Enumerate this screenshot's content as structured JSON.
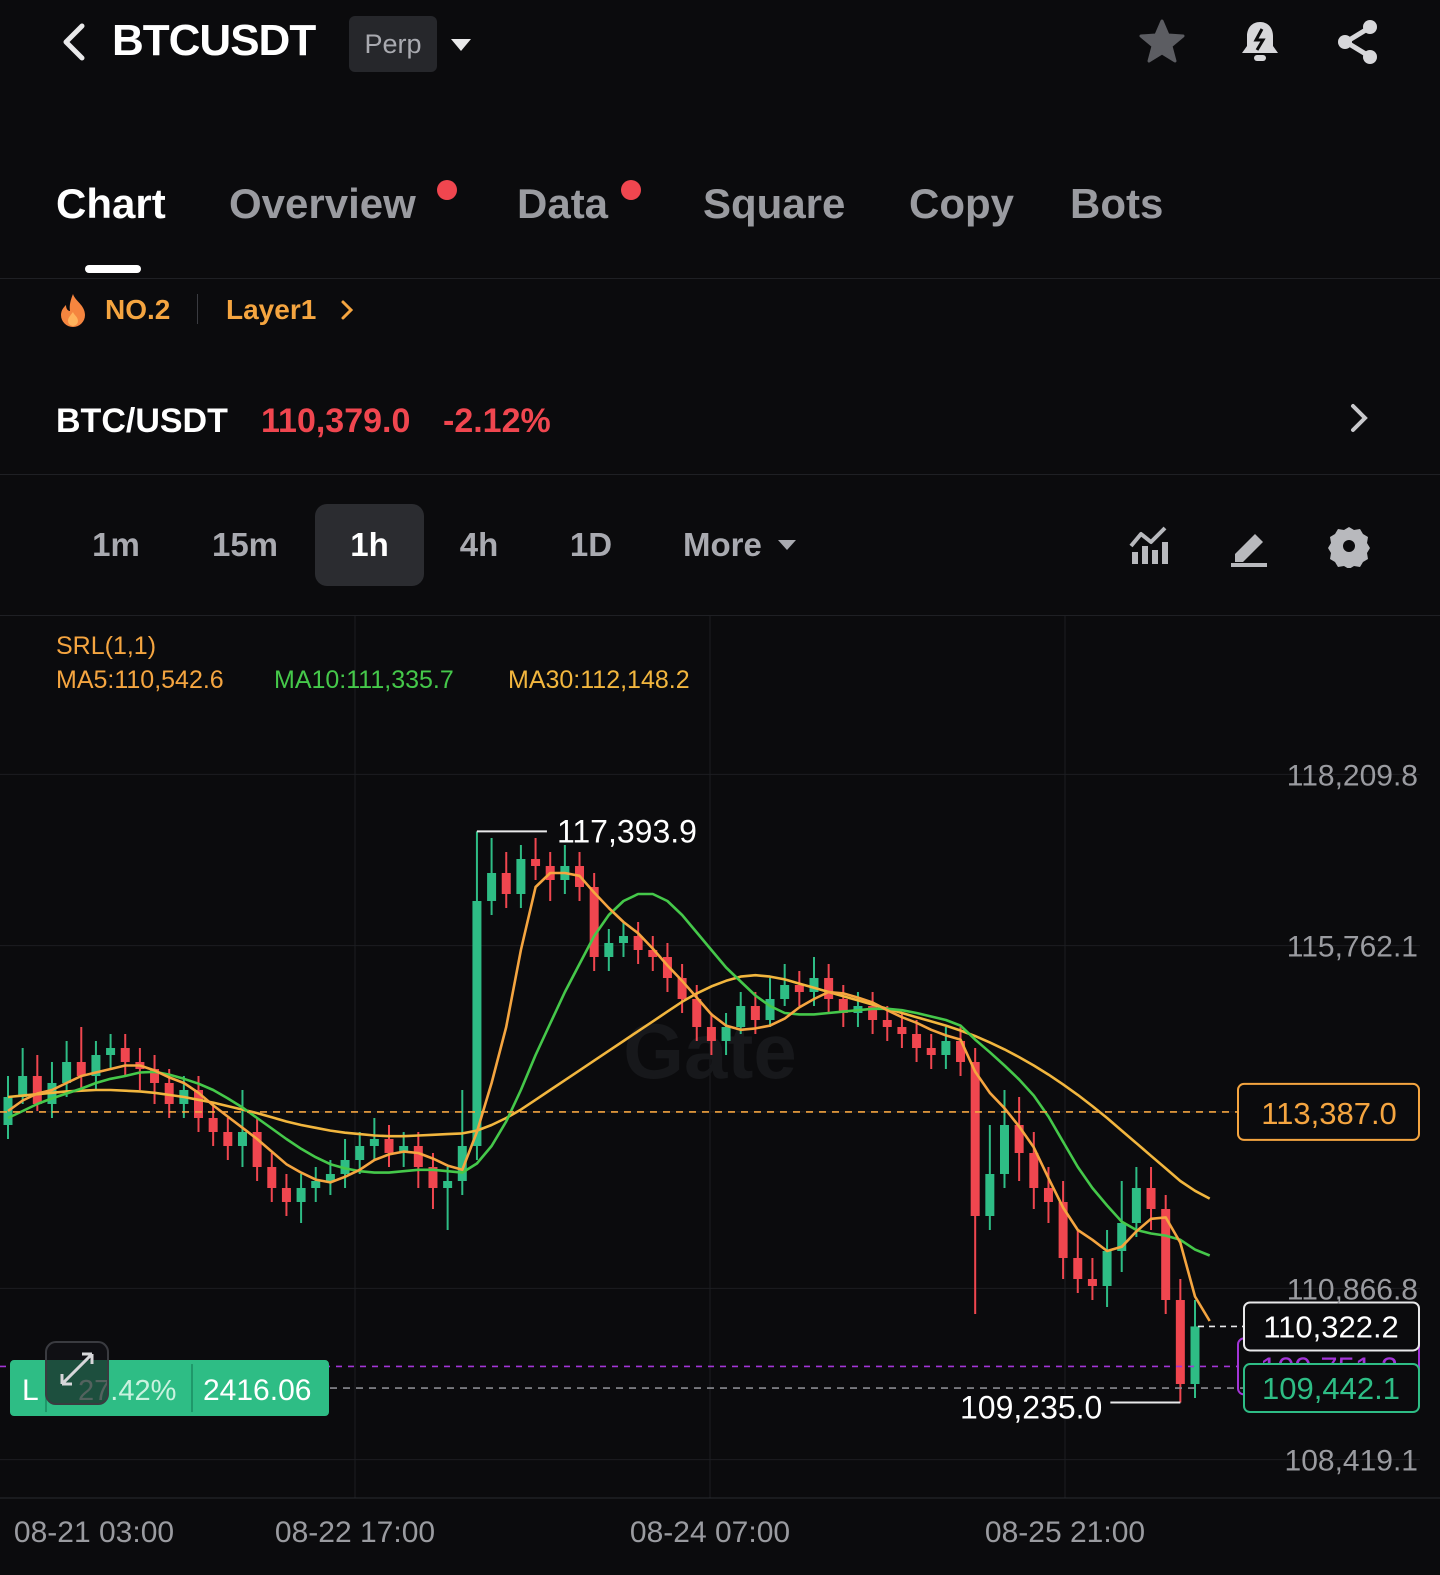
{
  "header": {
    "symbol": "BTCUSDT",
    "contract_type": "Perp",
    "icons": [
      "back-icon",
      "star-icon",
      "bell-icon",
      "share-icon"
    ]
  },
  "tabs": [
    {
      "label": "Chart",
      "active": true,
      "dot": false
    },
    {
      "label": "Overview",
      "active": false,
      "dot": true
    },
    {
      "label": "Data",
      "active": false,
      "dot": true
    },
    {
      "label": "Square",
      "active": false,
      "dot": false
    },
    {
      "label": "Copy",
      "active": false,
      "dot": false
    },
    {
      "label": "Bots",
      "active": false,
      "dot": false
    }
  ],
  "rank": {
    "label": "NO.2",
    "category": "Layer1"
  },
  "pair": {
    "name": "BTC/USDT",
    "price": "110,379.0",
    "change": "-2.12%"
  },
  "intervals": {
    "items": [
      "1m",
      "15m",
      "1h",
      "4h",
      "1D"
    ],
    "active": "1h",
    "more": "More"
  },
  "chart": {
    "indicator_title": "SRL(1,1)",
    "ma5": "MA5:110,542.6",
    "ma10": "MA10:111,335.7",
    "ma30": "MA30:112,148.2",
    "watermark": "Gate",
    "high_marker": "117,393.9",
    "low_marker": "109,235.0",
    "alert_price": "113,387.0",
    "last_price": "110,322.2",
    "hidden_price": "109,751.2",
    "mark_price": "109,442.1",
    "position": {
      "side": "L",
      "pnl": "27.42%",
      "size": "2416.06"
    }
  },
  "colors": {
    "up": "#2ebd85",
    "down": "#f0464f",
    "ma5": "#f5a540",
    "ma10": "#45c84a",
    "ma30": "#f2b63e",
    "accent": "#f5a540",
    "background": "#0b0b0d"
  },
  "chart_data": {
    "type": "candlestick",
    "title": "",
    "xlabel": "",
    "ylabel": "",
    "ylim": [
      107900,
      118900
    ],
    "y_ticks": [
      "118,209.8",
      "115,762.1",
      "113,387.0",
      "110,866.8",
      "108,419.1"
    ],
    "x_ticks": [
      "08-21 03:00",
      "08-22 17:00",
      "08-24 07:00",
      "08-25 21:00"
    ],
    "high": 117393.9,
    "low": 109235.0,
    "candles": [
      {
        "o": 113200,
        "c": 113600,
        "h": 113900,
        "l": 113000
      },
      {
        "o": 113600,
        "c": 113900,
        "h": 114300,
        "l": 113500
      },
      {
        "o": 113900,
        "c": 113500,
        "h": 114200,
        "l": 113400
      },
      {
        "o": 113500,
        "c": 113800,
        "h": 114100,
        "l": 113300
      },
      {
        "o": 113800,
        "c": 114100,
        "h": 114400,
        "l": 113600
      },
      {
        "o": 114100,
        "c": 113900,
        "h": 114600,
        "l": 113700
      },
      {
        "o": 113900,
        "c": 114200,
        "h": 114400,
        "l": 113700
      },
      {
        "o": 114200,
        "c": 114300,
        "h": 114500,
        "l": 114000
      },
      {
        "o": 114300,
        "c": 114100,
        "h": 114500,
        "l": 113900
      },
      {
        "o": 114100,
        "c": 114000,
        "h": 114300,
        "l": 113700
      },
      {
        "o": 114000,
        "c": 113800,
        "h": 114200,
        "l": 113500
      },
      {
        "o": 113800,
        "c": 113500,
        "h": 114000,
        "l": 113300
      },
      {
        "o": 113500,
        "c": 113700,
        "h": 113900,
        "l": 113300
      },
      {
        "o": 113700,
        "c": 113300,
        "h": 113900,
        "l": 113100
      },
      {
        "o": 113300,
        "c": 113100,
        "h": 113500,
        "l": 112900
      },
      {
        "o": 113100,
        "c": 112900,
        "h": 113300,
        "l": 112700
      },
      {
        "o": 112900,
        "c": 113100,
        "h": 113700,
        "l": 112600
      },
      {
        "o": 113100,
        "c": 112600,
        "h": 113300,
        "l": 112400
      },
      {
        "o": 112600,
        "c": 112300,
        "h": 112800,
        "l": 112100
      },
      {
        "o": 112300,
        "c": 112100,
        "h": 112500,
        "l": 111900
      },
      {
        "o": 112100,
        "c": 112300,
        "h": 112500,
        "l": 111800
      },
      {
        "o": 112300,
        "c": 112400,
        "h": 112600,
        "l": 112100
      },
      {
        "o": 112400,
        "c": 112500,
        "h": 112700,
        "l": 112200
      },
      {
        "o": 112500,
        "c": 112700,
        "h": 113000,
        "l": 112300
      },
      {
        "o": 112700,
        "c": 112900,
        "h": 113100,
        "l": 112500
      },
      {
        "o": 112900,
        "c": 113000,
        "h": 113300,
        "l": 112700
      },
      {
        "o": 113000,
        "c": 112800,
        "h": 113200,
        "l": 112600
      },
      {
        "o": 112800,
        "c": 112900,
        "h": 113100,
        "l": 112600
      },
      {
        "o": 112900,
        "c": 112600,
        "h": 113100,
        "l": 112300
      },
      {
        "o": 112600,
        "c": 112300,
        "h": 112800,
        "l": 112000
      },
      {
        "o": 112300,
        "c": 112400,
        "h": 112600,
        "l": 111700
      },
      {
        "o": 112400,
        "c": 112900,
        "h": 113700,
        "l": 112200
      },
      {
        "o": 112900,
        "c": 116400,
        "h": 117393.9,
        "l": 112700
      },
      {
        "o": 116400,
        "c": 116800,
        "h": 117300,
        "l": 116200
      },
      {
        "o": 116800,
        "c": 116500,
        "h": 117100,
        "l": 116300
      },
      {
        "o": 116500,
        "c": 117000,
        "h": 117200,
        "l": 116300
      },
      {
        "o": 117000,
        "c": 116900,
        "h": 117300,
        "l": 116700
      },
      {
        "o": 116900,
        "c": 116700,
        "h": 117100,
        "l": 116400
      },
      {
        "o": 116700,
        "c": 116900,
        "h": 117200,
        "l": 116500
      },
      {
        "o": 116900,
        "c": 116600,
        "h": 117100,
        "l": 116400
      },
      {
        "o": 116600,
        "c": 115600,
        "h": 116800,
        "l": 115400
      },
      {
        "o": 115600,
        "c": 115800,
        "h": 116000,
        "l": 115400
      },
      {
        "o": 115800,
        "c": 115900,
        "h": 116100,
        "l": 115600
      },
      {
        "o": 115900,
        "c": 115700,
        "h": 116100,
        "l": 115500
      },
      {
        "o": 115700,
        "c": 115600,
        "h": 115900,
        "l": 115400
      },
      {
        "o": 115600,
        "c": 115300,
        "h": 115800,
        "l": 115100
      },
      {
        "o": 115300,
        "c": 115000,
        "h": 115500,
        "l": 114800
      },
      {
        "o": 115000,
        "c": 114600,
        "h": 115200,
        "l": 114400
      },
      {
        "o": 114600,
        "c": 114400,
        "h": 114800,
        "l": 114200
      },
      {
        "o": 114400,
        "c": 114600,
        "h": 114800,
        "l": 114200
      },
      {
        "o": 114600,
        "c": 114900,
        "h": 115100,
        "l": 114500
      },
      {
        "o": 114900,
        "c": 114700,
        "h": 115100,
        "l": 114500
      },
      {
        "o": 114700,
        "c": 115000,
        "h": 115300,
        "l": 114600
      },
      {
        "o": 115000,
        "c": 115200,
        "h": 115500,
        "l": 114900
      },
      {
        "o": 115200,
        "c": 115100,
        "h": 115400,
        "l": 114900
      },
      {
        "o": 115100,
        "c": 115300,
        "h": 115600,
        "l": 114900
      },
      {
        "o": 115300,
        "c": 115000,
        "h": 115500,
        "l": 114800
      },
      {
        "o": 115000,
        "c": 114800,
        "h": 115200,
        "l": 114600
      },
      {
        "o": 114800,
        "c": 114900,
        "h": 115100,
        "l": 114600
      },
      {
        "o": 114900,
        "c": 114700,
        "h": 115100,
        "l": 114500
      },
      {
        "o": 114700,
        "c": 114600,
        "h": 114900,
        "l": 114400
      },
      {
        "o": 114600,
        "c": 114500,
        "h": 114800,
        "l": 114300
      },
      {
        "o": 114500,
        "c": 114300,
        "h": 114700,
        "l": 114100
      },
      {
        "o": 114300,
        "c": 114200,
        "h": 114500,
        "l": 114000
      },
      {
        "o": 114200,
        "c": 114400,
        "h": 114600,
        "l": 114000
      },
      {
        "o": 114400,
        "c": 114100,
        "h": 114600,
        "l": 113900
      },
      {
        "o": 114100,
        "c": 111900,
        "h": 114300,
        "l": 110500
      },
      {
        "o": 111900,
        "c": 112500,
        "h": 113200,
        "l": 111700
      },
      {
        "o": 112500,
        "c": 113200,
        "h": 113700,
        "l": 112300
      },
      {
        "o": 113200,
        "c": 112800,
        "h": 113600,
        "l": 112400
      },
      {
        "o": 112800,
        "c": 112300,
        "h": 113100,
        "l": 112000
      },
      {
        "o": 112300,
        "c": 112100,
        "h": 112600,
        "l": 111800
      },
      {
        "o": 112100,
        "c": 111300,
        "h": 112400,
        "l": 111000
      },
      {
        "o": 111300,
        "c": 111000,
        "h": 111700,
        "l": 110800
      },
      {
        "o": 111000,
        "c": 110900,
        "h": 111300,
        "l": 110700
      },
      {
        "o": 110900,
        "c": 111400,
        "h": 111700,
        "l": 110600
      },
      {
        "o": 111400,
        "c": 111800,
        "h": 112400,
        "l": 111100
      },
      {
        "o": 111800,
        "c": 112300,
        "h": 112600,
        "l": 111600
      },
      {
        "o": 112300,
        "c": 112000,
        "h": 112600,
        "l": 111700
      },
      {
        "o": 112000,
        "c": 110700,
        "h": 112200,
        "l": 110500
      },
      {
        "o": 110700,
        "c": 109500,
        "h": 111000,
        "l": 109235.0
      },
      {
        "o": 109500,
        "c": 110322.2,
        "h": 110700,
        "l": 109300
      }
    ],
    "ma5": [
      113400,
      113550,
      113650,
      113700,
      113800,
      113900,
      113950,
      114000,
      114050,
      114050,
      113980,
      113880,
      113800,
      113660,
      113480,
      113320,
      113160,
      113000,
      112820,
      112640,
      112520,
      112420,
      112380,
      112460,
      112560,
      112700,
      112780,
      112820,
      112800,
      112720,
      112620,
      112560,
      113100,
      113800,
      114600,
      115700,
      116600,
      116800,
      116800,
      116760,
      116520,
      116300,
      116100,
      115940,
      115720,
      115480,
      115260,
      115020,
      114780,
      114620,
      114560,
      114580,
      114620,
      114720,
      114880,
      115000,
      115100,
      115080,
      115020,
      114950,
      114840,
      114740,
      114660,
      114560,
      114480,
      114420,
      113960,
      113660,
      113440,
      113180,
      112880,
      112440,
      112020,
      111700,
      111560,
      111400,
      111460,
      111680,
      111860,
      111880,
      111520,
      110750,
      110400
    ],
    "ma10": [
      113300,
      113400,
      113500,
      113580,
      113650,
      113720,
      113800,
      113860,
      113900,
      113950,
      113960,
      113920,
      113860,
      113790,
      113700,
      113580,
      113450,
      113300,
      113150,
      113000,
      112860,
      112740,
      112640,
      112580,
      112540,
      112520,
      112520,
      112540,
      112560,
      112560,
      112540,
      112520,
      112650,
      112900,
      113250,
      113700,
      114200,
      114650,
      115100,
      115500,
      115900,
      116200,
      116400,
      116500,
      116500,
      116400,
      116200,
      115950,
      115700,
      115450,
      115250,
      115050,
      114900,
      114800,
      114780,
      114780,
      114800,
      114820,
      114840,
      114860,
      114860,
      114840,
      114800,
      114750,
      114700,
      114620,
      114420,
      114240,
      114050,
      113850,
      113620,
      113320,
      112960,
      112600,
      112300,
      112050,
      111820,
      111700,
      111650,
      111620,
      111560,
      111420,
      111335.7
    ],
    "ma30": [
      113600,
      113620,
      113640,
      113660,
      113680,
      113690,
      113700,
      113700,
      113690,
      113680,
      113660,
      113630,
      113600,
      113560,
      113520,
      113470,
      113420,
      113370,
      113310,
      113250,
      113200,
      113160,
      113120,
      113090,
      113070,
      113050,
      113040,
      113040,
      113050,
      113060,
      113070,
      113080,
      113120,
      113200,
      113300,
      113420,
      113560,
      113700,
      113840,
      113980,
      114120,
      114260,
      114400,
      114540,
      114680,
      114820,
      114960,
      115080,
      115180,
      115260,
      115320,
      115340,
      115320,
      115280,
      115220,
      115160,
      115100,
      115040,
      114980,
      114920,
      114860,
      114800,
      114740,
      114680,
      114620,
      114550,
      114470,
      114380,
      114280,
      114170,
      114050,
      113920,
      113780,
      113630,
      113470,
      113300,
      113120,
      112940,
      112760,
      112580,
      112400,
      112260,
      112148.2
    ]
  }
}
